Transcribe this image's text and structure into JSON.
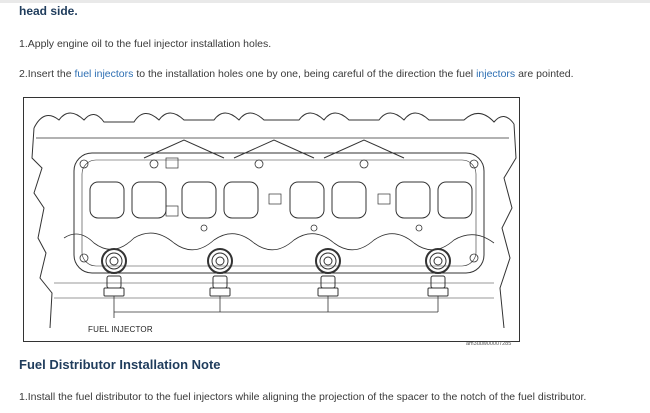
{
  "top_heading": "head side.",
  "steps": {
    "step1": "1.Apply engine oil to the fuel injector installation holes.",
    "step2_a": "2.Insert the ",
    "step2_link1": "fuel injectors",
    "step2_b": " to the installation holes one by one, being careful of the direction the fuel ",
    "step2_link2": "injectors",
    "step2_c": " are pointed.",
    "step3": "1.Install the fuel distributor to the fuel injectors while aligning the projection of the spacer to the notch of the fuel distributor."
  },
  "figure": {
    "label": "FUEL INJECTOR",
    "code": "am3uuw00007285"
  },
  "section_title": "Fuel Distributor Installation Note",
  "colors": {
    "heading": "#1f3c5c",
    "link": "#2e6fb3"
  }
}
